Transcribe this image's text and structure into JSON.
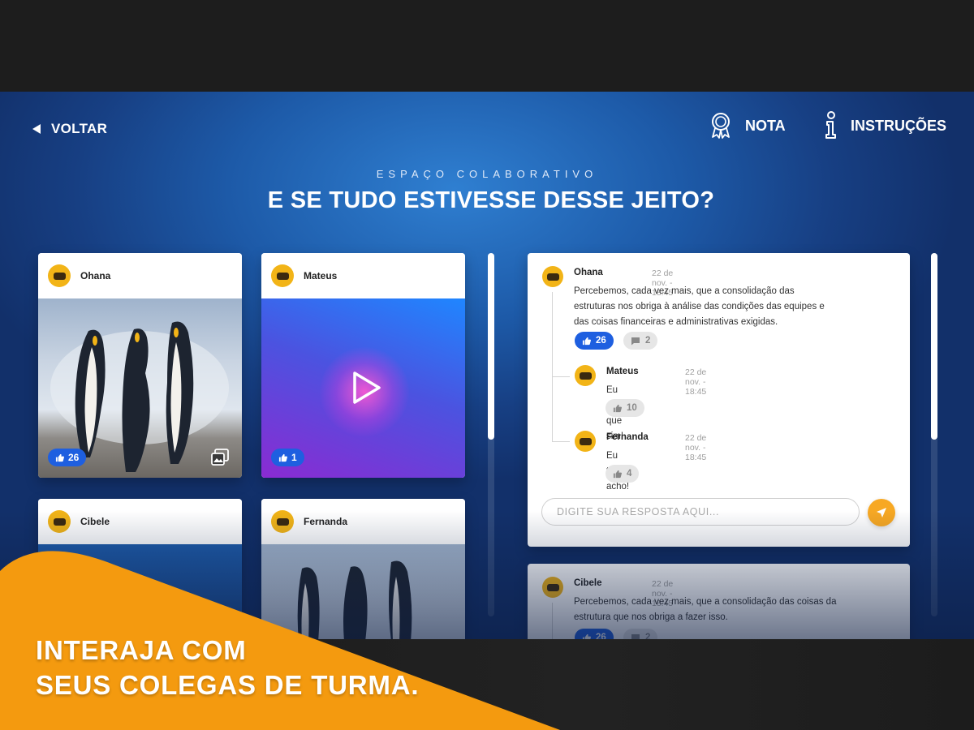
{
  "header": {
    "back_label": "VOLTAR",
    "nota_label": "NOTA",
    "instrucoes_label": "INSTRUÇÕES"
  },
  "section": {
    "kicker": "ESPAÇO COLABORATIVO",
    "title": "E SE TUDO ESTIVESSE DESSE JEITO?"
  },
  "posts": [
    {
      "author": "Ohana",
      "media": "image-penguins",
      "likes": "26",
      "icon": "gallery-icon"
    },
    {
      "author": "Mateus",
      "media": "video",
      "likes": "1",
      "icon": "play-icon"
    },
    {
      "author": "Cibele",
      "media": "image"
    },
    {
      "author": "Fernanda",
      "media": "image-penguins"
    }
  ],
  "threads": [
    {
      "author": "Ohana",
      "date": "22 de nov. - 18:45",
      "text_lines": [
        "Percebemos, cada vez mais, que a consolidação das",
        "estruturas nos obriga à análise das condições das equipes e",
        "das coisas financeiras e administrativas exigidas."
      ],
      "likes": "26",
      "comments": "2",
      "replies": [
        {
          "author": "Mateus",
          "date": "22 de nov. - 18:45",
          "text": "Eu acho que sim!",
          "likes": "10"
        },
        {
          "author": "Fernanda",
          "date": "22 de nov. - 18:45",
          "text": "Eu tbm acho!",
          "likes": "4"
        }
      ],
      "reply_placeholder": "DIGITE SUA RESPOSTA AQUI..."
    },
    {
      "author": "Cibele",
      "date": "22 de nov. - 18:45",
      "text_lines": [
        "Percebemos, cada vez mais, que a consolidação das coisas da",
        "estrutura que nos obriga a fazer isso."
      ],
      "likes": "26",
      "comments": "2"
    }
  ],
  "promo": {
    "line1": "INTERAJA COM",
    "line2": "SEUS COLEGAS DE TURMA."
  },
  "colors": {
    "accent_orange": "#f5a012",
    "like_blue": "#1e5fe0",
    "avatar_yellow": "#f2b417"
  }
}
